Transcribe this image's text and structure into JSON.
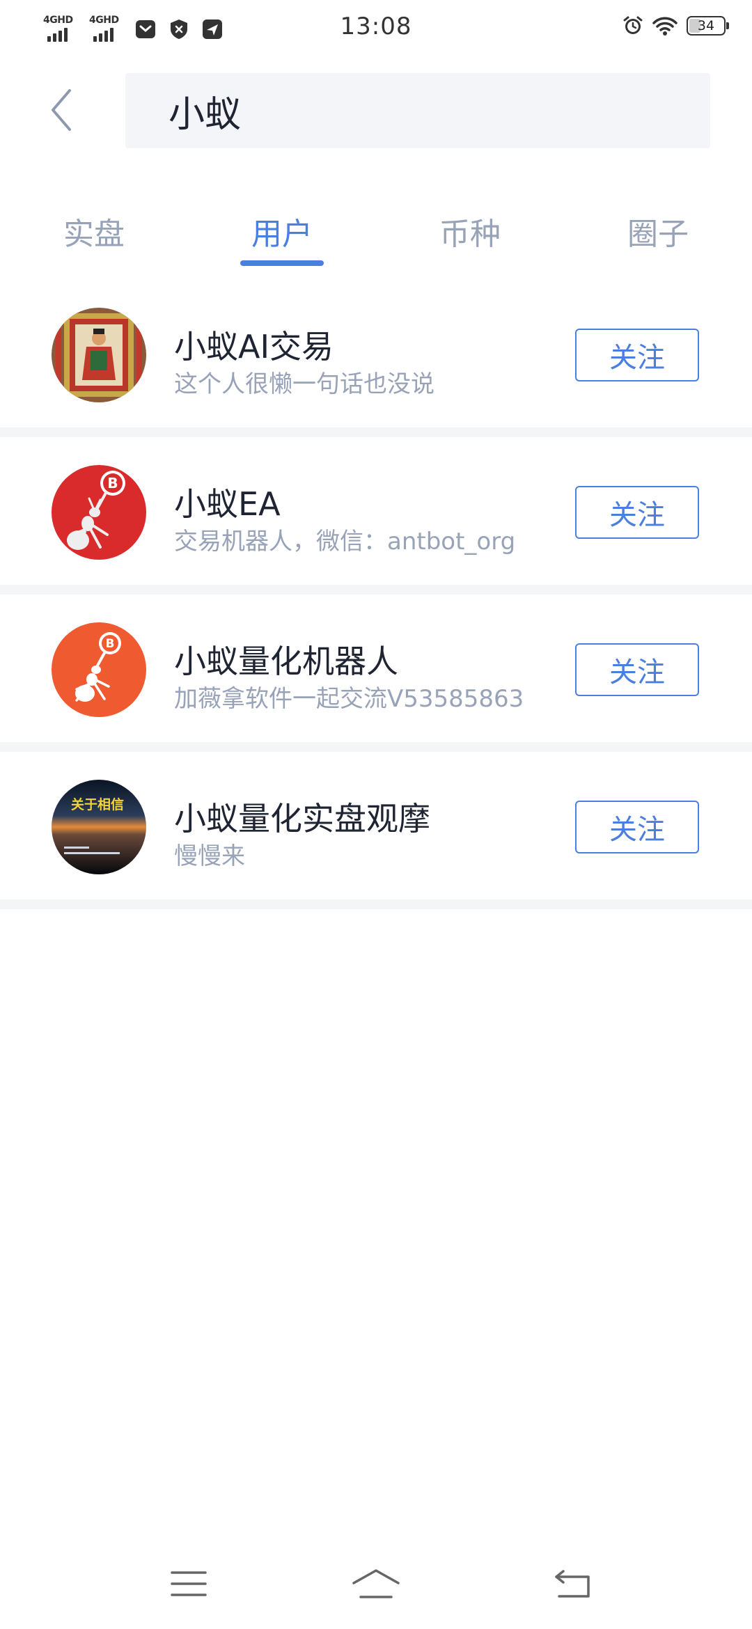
{
  "status_bar": {
    "time": "13:08",
    "signal_1_label": "4GHD",
    "signal_2_label": "4GHD",
    "battery_level": "34",
    "battery_fraction": 0.34,
    "icons": [
      "mail-icon",
      "shield-icon",
      "send-icon",
      "alarm-icon",
      "wifi-icon",
      "battery-icon"
    ]
  },
  "search": {
    "value": "小蚁",
    "placeholder": ""
  },
  "tabs": [
    {
      "label": "实盘",
      "active": false
    },
    {
      "label": "用户",
      "active": true
    },
    {
      "label": "币种",
      "active": false
    },
    {
      "label": "圈子",
      "active": false
    }
  ],
  "users": [
    {
      "name": "小蚁AI交易",
      "bio": "这个人很懒一句话也没说",
      "follow_label": "关注",
      "avatar": "deity-painting-avatar"
    },
    {
      "name": "小蚁EA",
      "bio": "交易机器人，微信：antbot_org",
      "follow_label": "关注",
      "avatar": "ant-bitcoin-red-avatar"
    },
    {
      "name": "小蚁量化机器人",
      "bio": "加薇拿软件一起交流V53585863",
      "follow_label": "关注",
      "avatar": "ant-bitcoin-orange-avatar"
    },
    {
      "name": "小蚁量化实盘观摩",
      "bio": "慢慢来",
      "follow_label": "关注",
      "avatar": "sunset-text-avatar",
      "avatar_text": "关于相信"
    }
  ],
  "colors": {
    "accent": "#4a7fe0",
    "muted_text": "#98a3b8",
    "primary_text": "#1f2433",
    "search_bg": "#f3f5f9",
    "separator": "#f4f5f7"
  },
  "bottom_nav": [
    "menu-icon",
    "home-icon",
    "back-icon"
  ]
}
